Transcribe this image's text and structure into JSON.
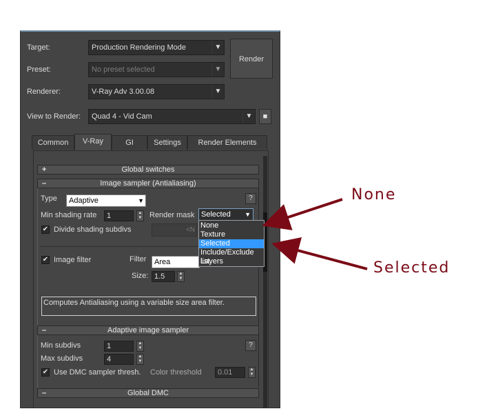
{
  "header": {
    "target_label": "Target:",
    "target_value": "Production Rendering Mode",
    "preset_label": "Preset:",
    "preset_value": "No preset selected",
    "renderer_label": "Renderer:",
    "renderer_value": "V-Ray Adv 3.00.08",
    "view_label": "View to Render:",
    "view_value": "Quad 4 - Vid Cam",
    "render_button": "Render"
  },
  "tabs": [
    {
      "label": "Common",
      "active": false
    },
    {
      "label": "V-Ray",
      "active": true
    },
    {
      "label": "GI",
      "active": false
    },
    {
      "label": "Settings",
      "active": false
    },
    {
      "label": "Render Elements",
      "active": false
    }
  ],
  "rollouts": {
    "global_switches": {
      "sign": "+",
      "title": "Global switches"
    },
    "image_sampler": {
      "sign": "–",
      "title": "Image sampler (Antialiasing)",
      "type_label": "Type",
      "type_value": "Adaptive",
      "min_shading_label": "Min shading rate",
      "min_shading_value": "1",
      "render_mask_label": "Render mask",
      "render_mask_value": "Selected",
      "divide_label": "Divide shading subdivs",
      "divide_checked": true,
      "disabled_placeholder": "<N",
      "help": "?"
    },
    "render_mask_options": [
      "None",
      "Texture",
      "Selected",
      "Include/Exclude list",
      "Layers"
    ],
    "render_mask_selected_index": 2,
    "image_filter": {
      "checkbox_label": "Image filter",
      "checked": true,
      "filter_label": "Filter",
      "filter_value": "Area",
      "size_label": "Size:",
      "size_value": "1.5",
      "description": "Computes Antialiasing using a variable size area filter."
    },
    "adaptive_sampler": {
      "sign": "–",
      "title": "Adaptive image sampler",
      "min_subdivs_label": "Min subdivs",
      "min_subdivs_value": "1",
      "max_subdivs_label": "Max subdivs",
      "max_subdivs_value": "4",
      "use_dmc_label": "Use DMC sampler thresh.",
      "use_dmc_checked": true,
      "color_threshold_label": "Color threshold",
      "color_threshold_value": "0.01",
      "help": "?"
    },
    "global_dmc": {
      "sign": "–",
      "title": "Global DMC"
    }
  },
  "annotations": {
    "none_label": "None",
    "selected_label": "Selected",
    "color": "#7a0b16"
  },
  "icons": {
    "check": "✔",
    "lock": "🔒",
    "arrow_down": "▼",
    "spin_up": "▲",
    "spin_down": "▼"
  }
}
